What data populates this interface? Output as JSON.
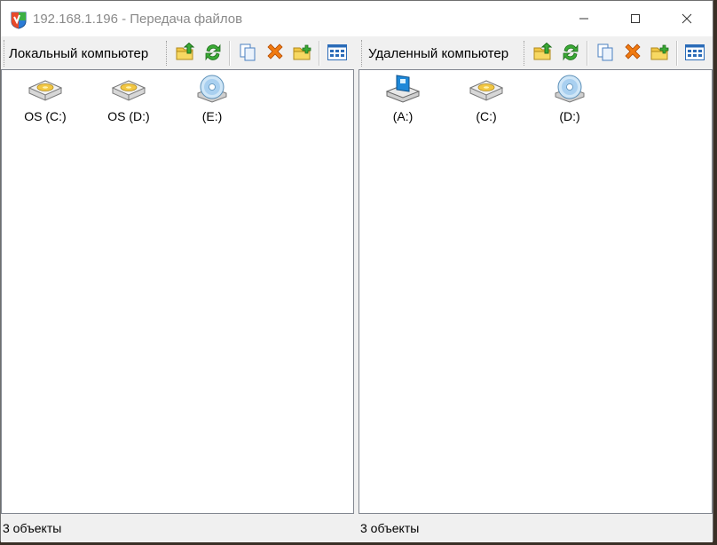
{
  "window": {
    "title": "192.168.1.196 - Передача файлов",
    "controls": [
      "minimize-icon",
      "maximize-icon",
      "close-icon"
    ]
  },
  "local": {
    "label": "Локальный компьютер",
    "toolbar": [
      "folder-up-icon",
      "refresh-icon",
      "copy-icon",
      "delete-icon",
      "new-folder-icon",
      "view-icon"
    ],
    "items": [
      {
        "label": "OS (C:)",
        "icon": "hard-drive-icon"
      },
      {
        "label": "OS (D:)",
        "icon": "hard-drive-icon"
      },
      {
        "label": "(E:)",
        "icon": "cd-drive-icon"
      }
    ],
    "status": "3 объекты"
  },
  "remote": {
    "label": "Удаленный компьютер",
    "toolbar": [
      "folder-up-icon",
      "refresh-icon",
      "copy-icon",
      "delete-icon",
      "new-folder-icon",
      "view-icon"
    ],
    "items": [
      {
        "label": "(A:)",
        "icon": "floppy-drive-icon"
      },
      {
        "label": "(C:)",
        "icon": "hard-drive-icon"
      },
      {
        "label": "(D:)",
        "icon": "cd-drive-icon"
      }
    ],
    "status": "3 объекты"
  },
  "colors": {
    "folder": "#f2c744",
    "refresh": "#2e9e2e",
    "delete": "#e05a00",
    "view": "#2a6bb8"
  }
}
